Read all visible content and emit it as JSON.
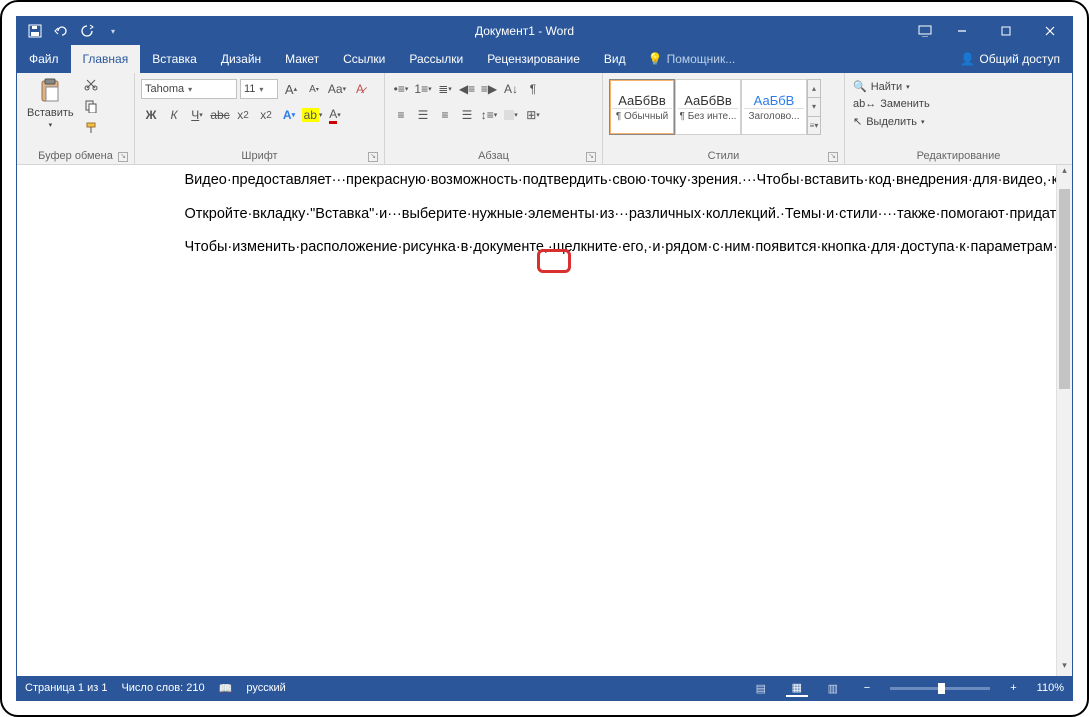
{
  "title": "Документ1 - Word",
  "menu": {
    "file": "Файл",
    "home": "Главная",
    "insert": "Вставка",
    "design": "Дизайн",
    "layout": "Макет",
    "references": "Ссылки",
    "mailings": "Рассылки",
    "review": "Рецензирование",
    "view": "Вид",
    "tell": "Помощник...",
    "share": "Общий доступ"
  },
  "ribbon": {
    "clipboard": {
      "label": "Буфер обмена",
      "paste": "Вставить"
    },
    "font": {
      "label": "Шрифт",
      "name": "Tahoma",
      "size": "11"
    },
    "paragraph": {
      "label": "Абзац"
    },
    "styles": {
      "label": "Стили",
      "preview": "АаБбВв",
      "preview_blue": "АаБбВ",
      "s1": "¶ Обычный",
      "s2": "¶ Без инте...",
      "s3": "Заголово..."
    },
    "editing": {
      "label": "Редактирование",
      "find": "Найти",
      "replace": "Заменить",
      "select": "Выделить"
    }
  },
  "doc": {
    "p1": "Видео·предоставляет···прекрасную·возможность·подтвердить·свою·точку·зрения.···Чтобы·вставить·код·внедрения·для·видео,·которое·вы·хотите·добавить,·нажмите·\"Видео·в·сети\".·Вы·также·можете···ввести·ключевое·слово,····чтобы·найти·в·Интернете·видео,·которое·лучше·всего·подходит···для·вашего·документа.·Чтобы·придать·документу··профессиональный·вид,·воспользуйтесь···доступными·в·Word·макетами·верхних·и·нижних·колонтитулов,···титульной·страницы·и···текстовых·полей,·которые···дополняют·друг·друга.·Например.····вы·можете·добавить···подходящую·титульную·страницу,·верхний···колонтитул·и·боковое·примечание.·¶",
    "p2": "Откройте·вкладку·\"Вставка\"·и···выберите·нужные·элементы·из···различных·коллекций.·Темы·и·стили····также·помогают·придать·документу·единообразный·вид.···Если·на·вкладке·\"Конструктор\"·выбрать·другую·тему.····то·изображения,·диаграммы·и·графические·элементы·SmartArt····изменятся·соответствующим·образом.···При·применении·стилей···заголовки·изменяются·в·соответствии····с·новой·темой.·Новые·кнопки,·которые·видны,·только·если·они·действительно·нужны,·экономят·время·при·работе·в·Word.¶",
    "p3": "Чтобы·изменить·расположение·рисунка·в·документе,·щелкните·его,·и·рядом·с·ним·появится·кнопка·для·доступа·к·параметрам·разметки.·При·работе·с·таблицей·щелкните·то·место,·куда·нужно·добавить·строку·или·столбец,·и·щелкните·знак·\"плюс\".·Читать·тоже·стало·проще·благодаря·новому·режиму·чтения.·Можно·свернуть·части·документа,·чтобы·сосредоточиться·на·нужном·фрагменте·текста.·Если·вы·прервете·чтение,·не·дойдя·до·конца·документа,·Word·запомнит,·в·каком·месте·вы·остановились·(даже·на·другом·устройстве).¶"
  },
  "status": {
    "page": "Страница 1 из 1",
    "words": "Число слов: 210",
    "lang": "русский",
    "zoom": "110%"
  }
}
